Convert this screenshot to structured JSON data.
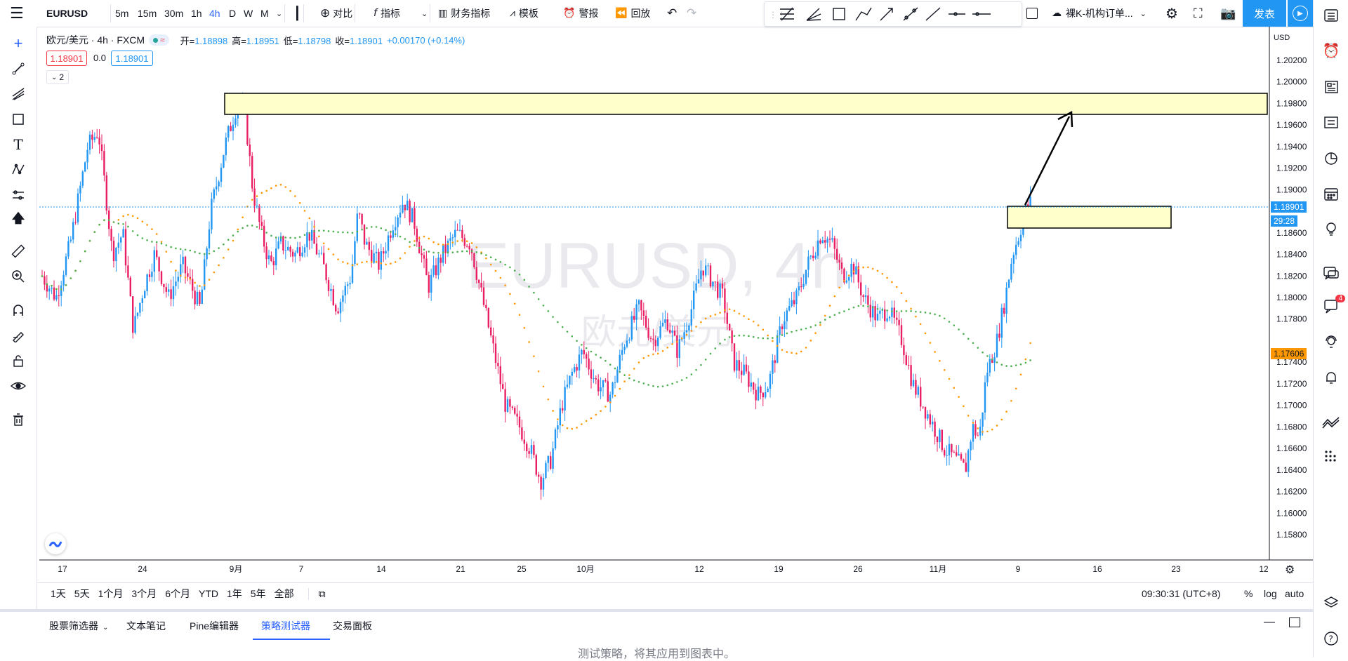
{
  "topbar": {
    "symbol": "EURUSD",
    "intervals": [
      "5m",
      "15m",
      "30m",
      "1h",
      "4h",
      "D",
      "W",
      "M"
    ],
    "active_interval": "4h",
    "compare_label": "对比",
    "indicators_label": "指标",
    "financials_label": "财务指标",
    "templates_label": "模板",
    "alert_label": "警报",
    "replay_label": "回放",
    "layout_name": "裸K-机构订单...",
    "publish_label": "发表"
  },
  "legend": {
    "title": "欧元/美元 · 4h · FXCM",
    "open_label": "开=",
    "open": "1.18898",
    "high_label": "高=",
    "high": "1.18951",
    "low_label": "低=",
    "low": "1.18798",
    "close_label": "收=",
    "close": "1.18901",
    "change": "+0.00170 (+0.14%)",
    "sell_price": "1.18901",
    "spread": "0.0",
    "buy_price": "1.18901",
    "indicators_count": "2"
  },
  "watermark": {
    "main": "EURUSD, 4h",
    "sub": "欧元/美元"
  },
  "price_axis": {
    "currency": "USD",
    "ticks": [
      "1.20200",
      "1.20000",
      "1.19800",
      "1.19600",
      "1.19400",
      "1.19200",
      "1.19000",
      "1.18600",
      "1.18400",
      "1.18200",
      "1.18000",
      "1.17800",
      "1.17400",
      "1.17200",
      "1.17000",
      "1.16800",
      "1.16600",
      "1.16400",
      "1.16200",
      "1.16000",
      "1.15800"
    ],
    "current_price": "1.18901",
    "countdown": "29:28",
    "ma_price": "1.17606"
  },
  "time_axis": {
    "labels": [
      "17",
      "24",
      "9月",
      "7",
      "14",
      "21",
      "25",
      "10月",
      "12",
      "19",
      "26",
      "11月",
      "9",
      "16",
      "23",
      "12"
    ]
  },
  "bottombar": {
    "ranges": [
      "1天",
      "5天",
      "1个月",
      "3个月",
      "6个月",
      "YTD",
      "1年",
      "5年",
      "全部"
    ],
    "clock": "09:30:31 (UTC+8)",
    "percent": "%",
    "log": "log",
    "auto": "auto"
  },
  "panel": {
    "tabs": [
      "股票筛选器",
      "文本笔记",
      "Pine编辑器",
      "策略测试器",
      "交易面板"
    ],
    "active_tab": "策略测试器",
    "message": "测试策略，将其应用到图表中。"
  },
  "notifications_badge": "4",
  "colors": {
    "up": "#2196f3",
    "down": "#e91e63",
    "ma_fast": "#ff9800",
    "ma_slow": "#4caf50",
    "zone_fill": "#ffffcc",
    "accent": "#2962ff"
  }
}
